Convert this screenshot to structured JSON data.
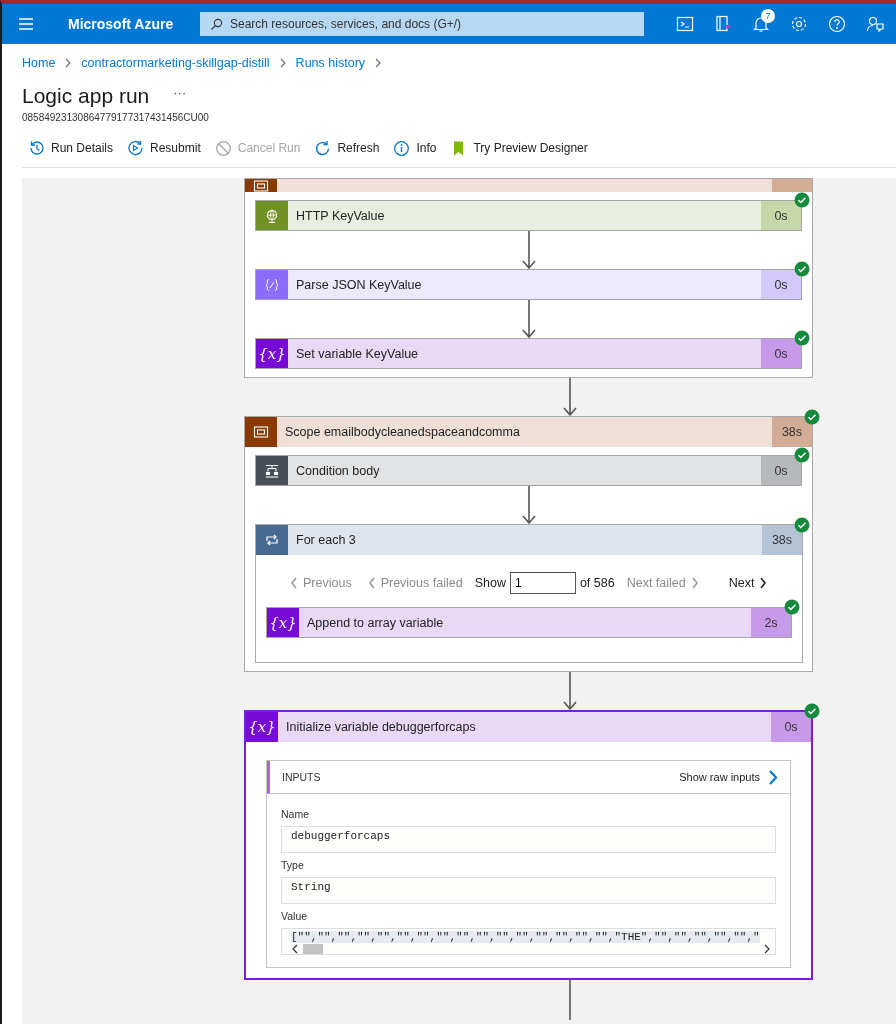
{
  "topbar": {
    "brand": "Microsoft Azure",
    "search": {
      "placeholder": "Search resources, services, and docs (G+/)"
    },
    "icons": [
      {
        "kind": "terminal"
      },
      {
        "kind": "directory"
      },
      {
        "kind": "bell",
        "badge": "7"
      },
      {
        "kind": "gear"
      },
      {
        "kind": "help"
      },
      {
        "kind": "feedback"
      }
    ]
  },
  "breadcrumb": [
    "Home",
    "contractormarketing-skillgap-distill",
    "Runs history"
  ],
  "page": {
    "title": "Logic app run",
    "more": "···",
    "run_id": "08584923130864779177317431456CU00"
  },
  "toolbar": [
    {
      "kind": "history",
      "label": "Run Details",
      "disabled": false
    },
    {
      "kind": "resubmit",
      "label": "Resubmit",
      "disabled": false
    },
    {
      "kind": "cancel",
      "label": "Cancel Run",
      "disabled": true
    },
    {
      "kind": "refresh",
      "label": "Refresh",
      "disabled": false
    },
    {
      "kind": "info",
      "label": "Info",
      "disabled": false
    },
    {
      "kind": "preview",
      "label": "Try Preview Designer",
      "disabled": false
    }
  ],
  "flow": [
    {
      "kind": "scope",
      "children": [
        {
          "kind": "http",
          "title": "HTTP KeyValue",
          "duration": "0s",
          "succeeded": true
        },
        {
          "kind": "parse_json",
          "title": "Parse JSON KeyValue",
          "duration": "0s",
          "succeeded": true
        },
        {
          "kind": "variable",
          "glyph": "{x}",
          "title": "Set variable KeyValue",
          "duration": "0s",
          "succeeded": true
        }
      ]
    },
    {
      "kind": "scope",
      "title": "Scope emailbodycleanedspaceandcomma",
      "duration": "38s",
      "succeeded": true,
      "children": [
        {
          "kind": "condition",
          "title": "Condition body",
          "duration": "0s",
          "succeeded": true
        },
        {
          "kind": "foreach",
          "title": "For each 3",
          "duration": "38s",
          "succeeded": true,
          "pager": {
            "previous": {
              "label": "Previous",
              "disabled": true
            },
            "previous_failed": {
              "label": "Previous failed",
              "disabled": true
            },
            "show_label": "Show",
            "value": "1",
            "of": "of 586",
            "next_failed": {
              "label": "Next failed",
              "disabled": true
            },
            "next": {
              "label": "Next",
              "disabled": false
            }
          },
          "children": [
            {
              "kind": "variable",
              "glyph": "{x}",
              "title": "Append to array variable",
              "duration": "2s",
              "succeeded": true
            }
          ]
        }
      ]
    },
    {
      "kind": "variable",
      "glyph": "{x}",
      "title": "Initialize variable debuggerforcaps",
      "duration": "0s",
      "succeeded": true,
      "selected": true,
      "inputs": {
        "heading": "INPUTS",
        "raw_link": "Show raw inputs",
        "fields": [
          {
            "label": "Name",
            "value": "debuggerforcaps",
            "scrollable": false
          },
          {
            "label": "Type",
            "value": "String",
            "scrollable": false
          },
          {
            "label": "Value",
            "value": "[\"\",\"\",\"\",\"\",\"\",\"\",\"\",\"\",\"\",\"\",\"\",\"\",\"\",\"\",\"\",\"\",\"THE\",\"\",\"\",\"\",\"\",\"\",\"",
            "scrollable": true
          }
        ]
      }
    }
  ]
}
